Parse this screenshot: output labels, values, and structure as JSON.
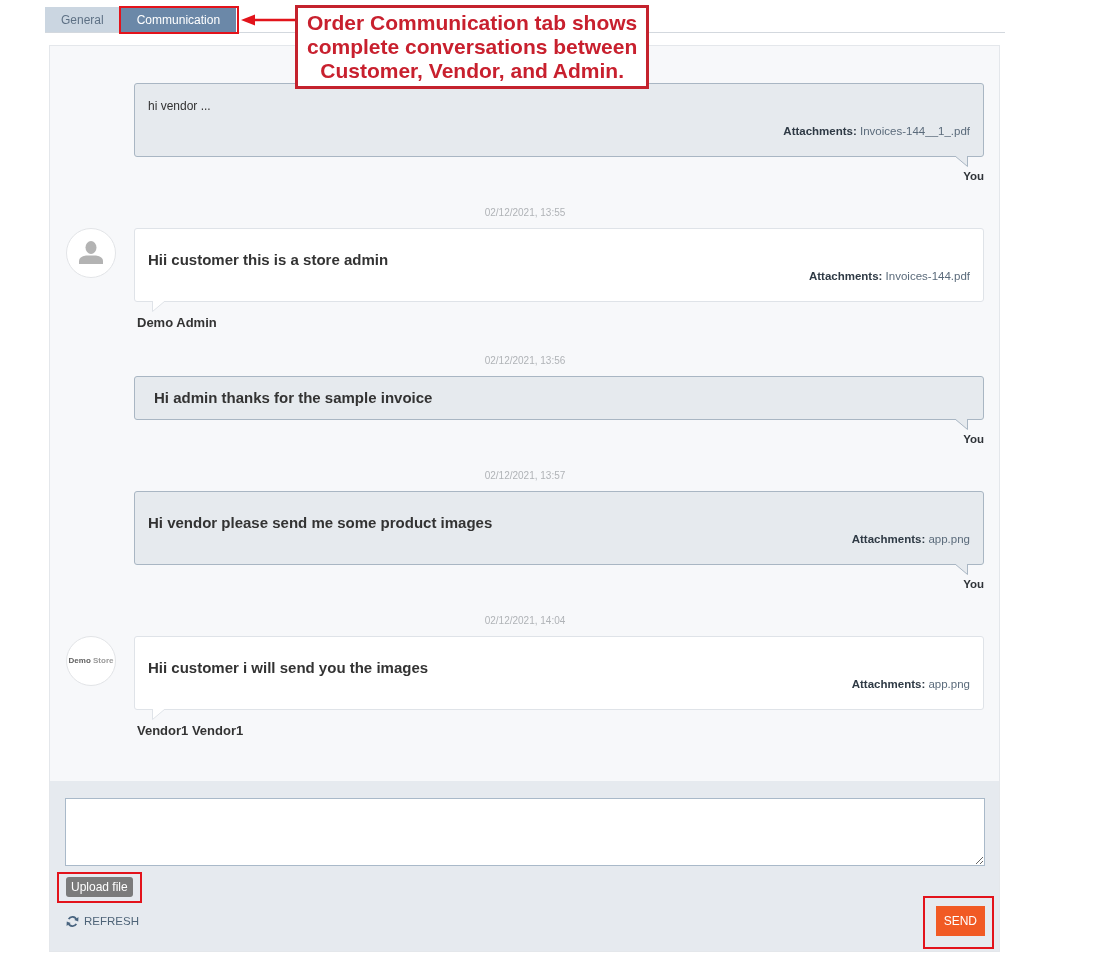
{
  "tabs": [
    {
      "label": "General",
      "selected": false,
      "highlighted": false
    },
    {
      "label": "Communication",
      "selected": true,
      "highlighted": true
    }
  ],
  "callout": {
    "text": "Order Communication tab shows\ncomplete conversations between\nCustomer, Vendor, and Admin."
  },
  "messages": [
    {
      "kind": "outgoing",
      "text": "hi vendor ...",
      "bold": false,
      "attachment": {
        "label": "Attachments:",
        "file": "Invoices-144__1_.pdf"
      },
      "sender": "You"
    },
    {
      "timestamp": "02/12/2021, 13:55",
      "kind": "incoming",
      "avatar": {
        "kind": "silhouette"
      },
      "text": "Hii customer this is a store admin",
      "bold": true,
      "attachment": {
        "label": "Attachments:",
        "file": "Invoices-144.pdf"
      },
      "sender": "Demo Admin"
    },
    {
      "timestamp": "02/12/2021, 13:56",
      "kind": "outgoing",
      "text": "Hi admin thanks for the sample invoice",
      "bold": true,
      "sender": "You"
    },
    {
      "timestamp": "02/12/2021, 13:57",
      "kind": "outgoing",
      "text": "Hi vendor please send me some product images",
      "bold": true,
      "attachment": {
        "label": "Attachments:",
        "file": "app.png"
      },
      "sender": "You"
    },
    {
      "timestamp": "02/12/2021, 14:04",
      "kind": "incoming",
      "avatar": {
        "kind": "logo",
        "text": "**Demo** Store"
      },
      "text": "Hii customer i will send you the images",
      "bold": true,
      "attachment": {
        "label": "Attachments:",
        "file": "app.png"
      },
      "sender": "Vendor1 Vendor1"
    }
  ],
  "composer": {
    "upload_button": {
      "label": "Upload file",
      "highlighted": true
    },
    "refresh_button": {
      "label": "REFRESH"
    },
    "send_button": {
      "label": "SEND",
      "highlighted": true
    }
  }
}
